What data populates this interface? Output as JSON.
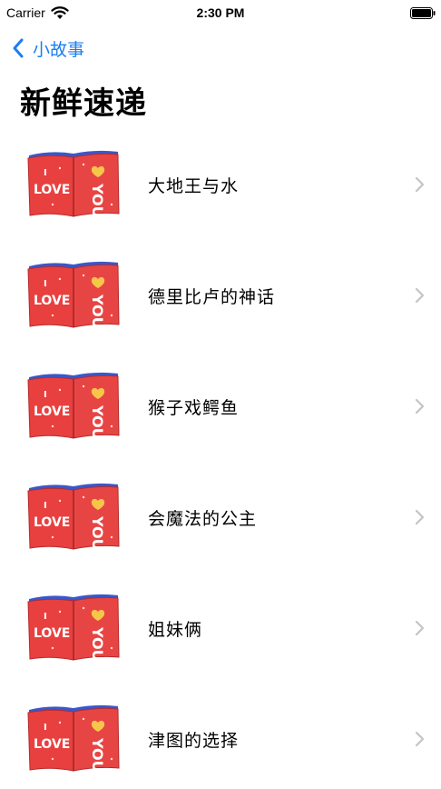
{
  "status_bar": {
    "carrier": "Carrier",
    "time": "2:30 PM"
  },
  "nav": {
    "back_label": "小故事",
    "title": "新鲜速递"
  },
  "colors": {
    "accent": "#1a7ef2",
    "book_red": "#e8403f",
    "book_spine": "#3a57c9",
    "chevron": "#c4c4c6"
  },
  "stories": [
    {
      "title": "大地王与水",
      "thumbnail": "love-you-book-icon"
    },
    {
      "title": "德里比卢的神话",
      "thumbnail": "love-you-book-icon"
    },
    {
      "title": "猴子戏鳄鱼",
      "thumbnail": "love-you-book-icon"
    },
    {
      "title": "会魔法的公主",
      "thumbnail": "love-you-book-icon"
    },
    {
      "title": "姐妹俩",
      "thumbnail": "love-you-book-icon"
    },
    {
      "title": "津图的选择",
      "thumbnail": "love-you-book-icon"
    }
  ]
}
